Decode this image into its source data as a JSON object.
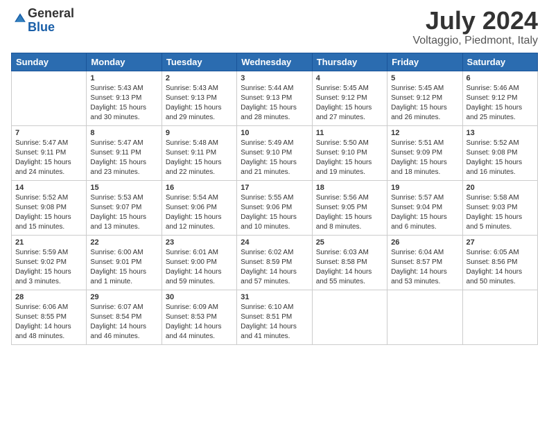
{
  "logo": {
    "general": "General",
    "blue": "Blue"
  },
  "header": {
    "title": "July 2024",
    "subtitle": "Voltaggio, Piedmont, Italy"
  },
  "weekdays": [
    "Sunday",
    "Monday",
    "Tuesday",
    "Wednesday",
    "Thursday",
    "Friday",
    "Saturday"
  ],
  "weeks": [
    [
      {
        "day": "",
        "info": ""
      },
      {
        "day": "1",
        "info": "Sunrise: 5:43 AM\nSunset: 9:13 PM\nDaylight: 15 hours\nand 30 minutes."
      },
      {
        "day": "2",
        "info": "Sunrise: 5:43 AM\nSunset: 9:13 PM\nDaylight: 15 hours\nand 29 minutes."
      },
      {
        "day": "3",
        "info": "Sunrise: 5:44 AM\nSunset: 9:13 PM\nDaylight: 15 hours\nand 28 minutes."
      },
      {
        "day": "4",
        "info": "Sunrise: 5:45 AM\nSunset: 9:12 PM\nDaylight: 15 hours\nand 27 minutes."
      },
      {
        "day": "5",
        "info": "Sunrise: 5:45 AM\nSunset: 9:12 PM\nDaylight: 15 hours\nand 26 minutes."
      },
      {
        "day": "6",
        "info": "Sunrise: 5:46 AM\nSunset: 9:12 PM\nDaylight: 15 hours\nand 25 minutes."
      }
    ],
    [
      {
        "day": "7",
        "info": "Sunrise: 5:47 AM\nSunset: 9:11 PM\nDaylight: 15 hours\nand 24 minutes."
      },
      {
        "day": "8",
        "info": "Sunrise: 5:47 AM\nSunset: 9:11 PM\nDaylight: 15 hours\nand 23 minutes."
      },
      {
        "day": "9",
        "info": "Sunrise: 5:48 AM\nSunset: 9:11 PM\nDaylight: 15 hours\nand 22 minutes."
      },
      {
        "day": "10",
        "info": "Sunrise: 5:49 AM\nSunset: 9:10 PM\nDaylight: 15 hours\nand 21 minutes."
      },
      {
        "day": "11",
        "info": "Sunrise: 5:50 AM\nSunset: 9:10 PM\nDaylight: 15 hours\nand 19 minutes."
      },
      {
        "day": "12",
        "info": "Sunrise: 5:51 AM\nSunset: 9:09 PM\nDaylight: 15 hours\nand 18 minutes."
      },
      {
        "day": "13",
        "info": "Sunrise: 5:52 AM\nSunset: 9:08 PM\nDaylight: 15 hours\nand 16 minutes."
      }
    ],
    [
      {
        "day": "14",
        "info": "Sunrise: 5:52 AM\nSunset: 9:08 PM\nDaylight: 15 hours\nand 15 minutes."
      },
      {
        "day": "15",
        "info": "Sunrise: 5:53 AM\nSunset: 9:07 PM\nDaylight: 15 hours\nand 13 minutes."
      },
      {
        "day": "16",
        "info": "Sunrise: 5:54 AM\nSunset: 9:06 PM\nDaylight: 15 hours\nand 12 minutes."
      },
      {
        "day": "17",
        "info": "Sunrise: 5:55 AM\nSunset: 9:06 PM\nDaylight: 15 hours\nand 10 minutes."
      },
      {
        "day": "18",
        "info": "Sunrise: 5:56 AM\nSunset: 9:05 PM\nDaylight: 15 hours\nand 8 minutes."
      },
      {
        "day": "19",
        "info": "Sunrise: 5:57 AM\nSunset: 9:04 PM\nDaylight: 15 hours\nand 6 minutes."
      },
      {
        "day": "20",
        "info": "Sunrise: 5:58 AM\nSunset: 9:03 PM\nDaylight: 15 hours\nand 5 minutes."
      }
    ],
    [
      {
        "day": "21",
        "info": "Sunrise: 5:59 AM\nSunset: 9:02 PM\nDaylight: 15 hours\nand 3 minutes."
      },
      {
        "day": "22",
        "info": "Sunrise: 6:00 AM\nSunset: 9:01 PM\nDaylight: 15 hours\nand 1 minute."
      },
      {
        "day": "23",
        "info": "Sunrise: 6:01 AM\nSunset: 9:00 PM\nDaylight: 14 hours\nand 59 minutes."
      },
      {
        "day": "24",
        "info": "Sunrise: 6:02 AM\nSunset: 8:59 PM\nDaylight: 14 hours\nand 57 minutes."
      },
      {
        "day": "25",
        "info": "Sunrise: 6:03 AM\nSunset: 8:58 PM\nDaylight: 14 hours\nand 55 minutes."
      },
      {
        "day": "26",
        "info": "Sunrise: 6:04 AM\nSunset: 8:57 PM\nDaylight: 14 hours\nand 53 minutes."
      },
      {
        "day": "27",
        "info": "Sunrise: 6:05 AM\nSunset: 8:56 PM\nDaylight: 14 hours\nand 50 minutes."
      }
    ],
    [
      {
        "day": "28",
        "info": "Sunrise: 6:06 AM\nSunset: 8:55 PM\nDaylight: 14 hours\nand 48 minutes."
      },
      {
        "day": "29",
        "info": "Sunrise: 6:07 AM\nSunset: 8:54 PM\nDaylight: 14 hours\nand 46 minutes."
      },
      {
        "day": "30",
        "info": "Sunrise: 6:09 AM\nSunset: 8:53 PM\nDaylight: 14 hours\nand 44 minutes."
      },
      {
        "day": "31",
        "info": "Sunrise: 6:10 AM\nSunset: 8:51 PM\nDaylight: 14 hours\nand 41 minutes."
      },
      {
        "day": "",
        "info": ""
      },
      {
        "day": "",
        "info": ""
      },
      {
        "day": "",
        "info": ""
      }
    ]
  ]
}
